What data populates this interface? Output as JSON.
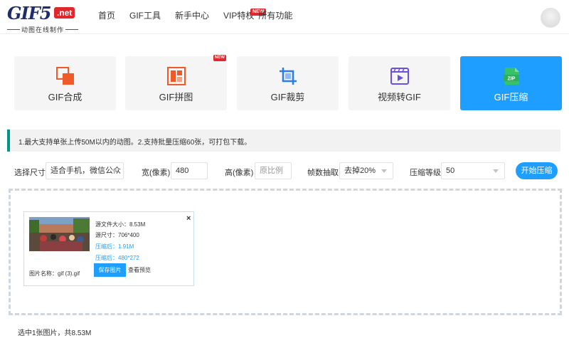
{
  "header": {
    "logo_main": "GIF5",
    "logo_net": ".net",
    "logo_sub": "动图在线制作",
    "nav": [
      {
        "label": "首页"
      },
      {
        "label": "GIF工具"
      },
      {
        "label": "新手中心"
      },
      {
        "label": "VIP特权",
        "badge": "NEW"
      },
      {
        "label": "所有功能"
      }
    ],
    "avatar_icon": "user-avatar-icon"
  },
  "tools": [
    {
      "label": "GIF合成",
      "icon": "gif-merge-icon",
      "color": "#f05a28"
    },
    {
      "label": "GIF拼图",
      "icon": "gif-puzzle-icon",
      "color": "#f05a28",
      "badge": "NEW"
    },
    {
      "label": "GIF裁剪",
      "icon": "crop-icon",
      "color": "#2b7de9"
    },
    {
      "label": "视频转GIF",
      "icon": "video-icon",
      "color": "#6a4fe0"
    },
    {
      "label": "GIF压缩",
      "icon": "zip-icon",
      "color": "#36c26b",
      "active": true
    }
  ],
  "notice": "1.最大支持单张上传50M以内的动图。2.支持批量压缩60张，可打包下载。",
  "options": {
    "size_label": "选择尺寸",
    "size_value": "适合手机，微信公众",
    "width_label": "宽(像素)",
    "width_value": "480",
    "height_label": "高(像素)",
    "height_placeholder": "原比例",
    "frame_label": "帧数抽取",
    "frame_value": "去掉20%",
    "level_label": "压缩等级",
    "level_value": "50",
    "start_button": "开始压缩"
  },
  "file_card": {
    "src_size": "源文件大小：8.53M",
    "src_dim": "源尺寸：706*400",
    "out_size": "压缩后：1.91M",
    "out_dim": "压缩后：480*272",
    "save_button": "保存图片",
    "preview_link": "查看预览",
    "file_name": "图片名称：gif (3).gif",
    "close": "×"
  },
  "summary": "选中1张图片，共8.53M",
  "colors": {
    "accent": "#1e9fff",
    "notice_bar": "#009688",
    "badge": "#e0282c"
  }
}
